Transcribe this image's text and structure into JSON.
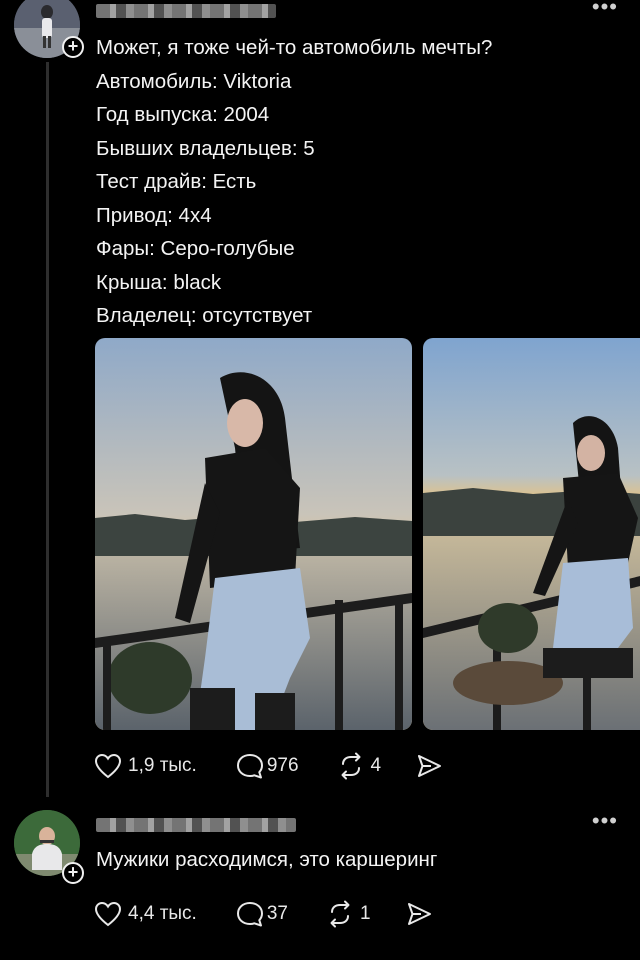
{
  "post": {
    "author_name": "",
    "menu_icon": "more-dots-icon",
    "lines": [
      "Может, я тоже чей-то автомобиль мечты?",
      "Автомобиль: Viktoria",
      "Год выпуска: 2004",
      "Бывших владельцев: 5",
      "Тест драйв: Есть",
      "Привод: 4х4",
      "Фары: Серо-голубые",
      "Крыша: black",
      "Владелец: отсутствует"
    ],
    "likes": "1,9 тыс.",
    "comments": "976",
    "reposts": "4"
  },
  "reply": {
    "author_name": "",
    "text": "Мужики расходимся, это каршеринг",
    "likes": "4,4 тыс.",
    "comments": "37",
    "reposts": "1"
  },
  "colors": {
    "background": "#000000",
    "text": "#f4f4f4",
    "thread_line": "#2e2e2e"
  }
}
